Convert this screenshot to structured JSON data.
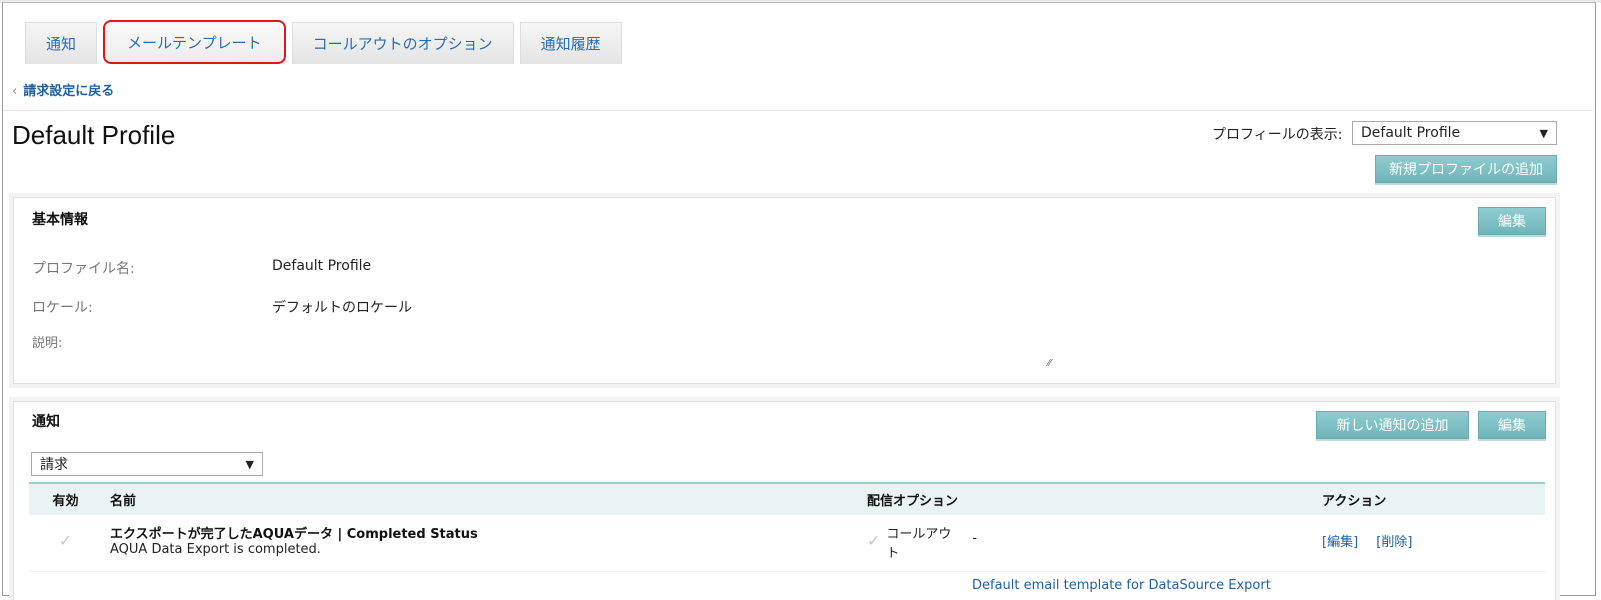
{
  "tabs": [
    {
      "label": "通知"
    },
    {
      "label": "メールテンプレート"
    },
    {
      "label": "コールアウトのオプション"
    },
    {
      "label": "通知履歴"
    }
  ],
  "back_link": "請求設定に戻る",
  "page_title": "Default Profile",
  "profile_selector": {
    "label": "プロフィールの表示:",
    "value": "Default Profile"
  },
  "add_profile_button": "新規プロファイルの追加",
  "basic_info": {
    "title": "基本情報",
    "edit_button": "編集",
    "fields": [
      {
        "label": "プロファイル名:",
        "value": "Default Profile"
      },
      {
        "label": "ロケール:",
        "value": "デフォルトのロケール"
      },
      {
        "label": "説明:",
        "value": ""
      }
    ]
  },
  "notifications": {
    "title": "通知",
    "add_button": "新しい通知の追加",
    "edit_button": "編集",
    "filter_value": "請求",
    "columns": [
      "有効",
      "名前",
      "配信オプション",
      "アクション"
    ],
    "rows": [
      {
        "name": "エクスポートが完了したAQUAデータ | Completed Status",
        "description": "AQUA Data Export is completed.",
        "delivery_option": "コールアウト",
        "delivery_extra": "-",
        "actions": [
          "[編集]",
          "[削除]"
        ]
      }
    ],
    "next_row_partial": "Default email template for DataSource Export"
  }
}
